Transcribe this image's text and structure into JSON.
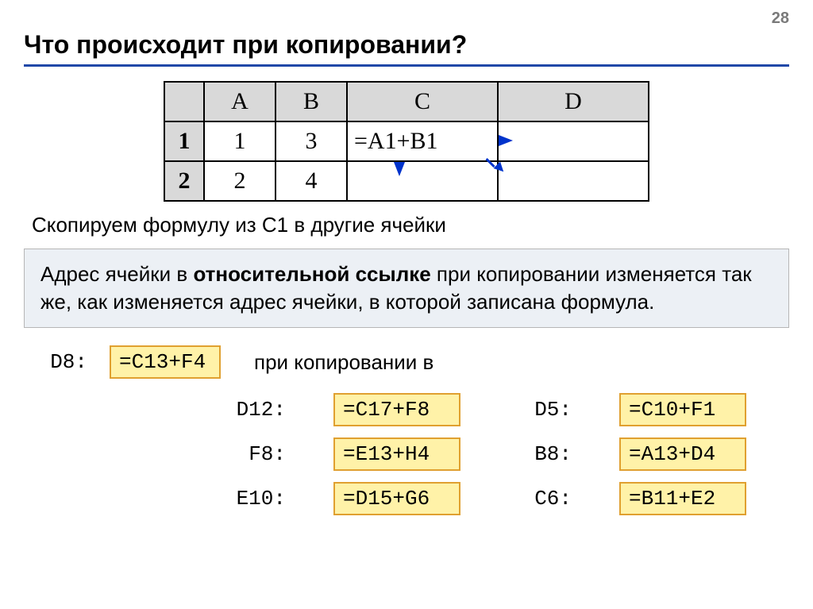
{
  "page_number": "28",
  "title": "Что происходит при копировании?",
  "spreadsheet": {
    "cols": [
      "A",
      "B",
      "C",
      "D"
    ],
    "rows": [
      "1",
      "2"
    ],
    "cells": {
      "A1": "1",
      "B1": "3",
      "C1": "=A1+B1",
      "D1": "",
      "A2": "2",
      "B2": "4",
      "C2": "",
      "D2": ""
    }
  },
  "caption": "Скопируем формулу из С1 в другие ячейки",
  "info": {
    "pre": "Адрес ячейки в ",
    "bold": "относительной ссылке",
    "post": " при копировании изменяется так же, как изменяется адрес ячейки, в которой записана формула."
  },
  "base": {
    "label": "D8:",
    "formula": "=C13+F4"
  },
  "copy_text": "при копировании в",
  "results": [
    {
      "label": "D12:",
      "formula": "=C17+F8"
    },
    {
      "label": "D5:",
      "formula": "=C10+F1"
    },
    {
      "label": "F8:",
      "formula": "=E13+H4"
    },
    {
      "label": "B8:",
      "formula": "=A13+D4"
    },
    {
      "label": "E10:",
      "formula": "=D15+G6"
    },
    {
      "label": "C6:",
      "formula": "=B11+E2"
    }
  ]
}
